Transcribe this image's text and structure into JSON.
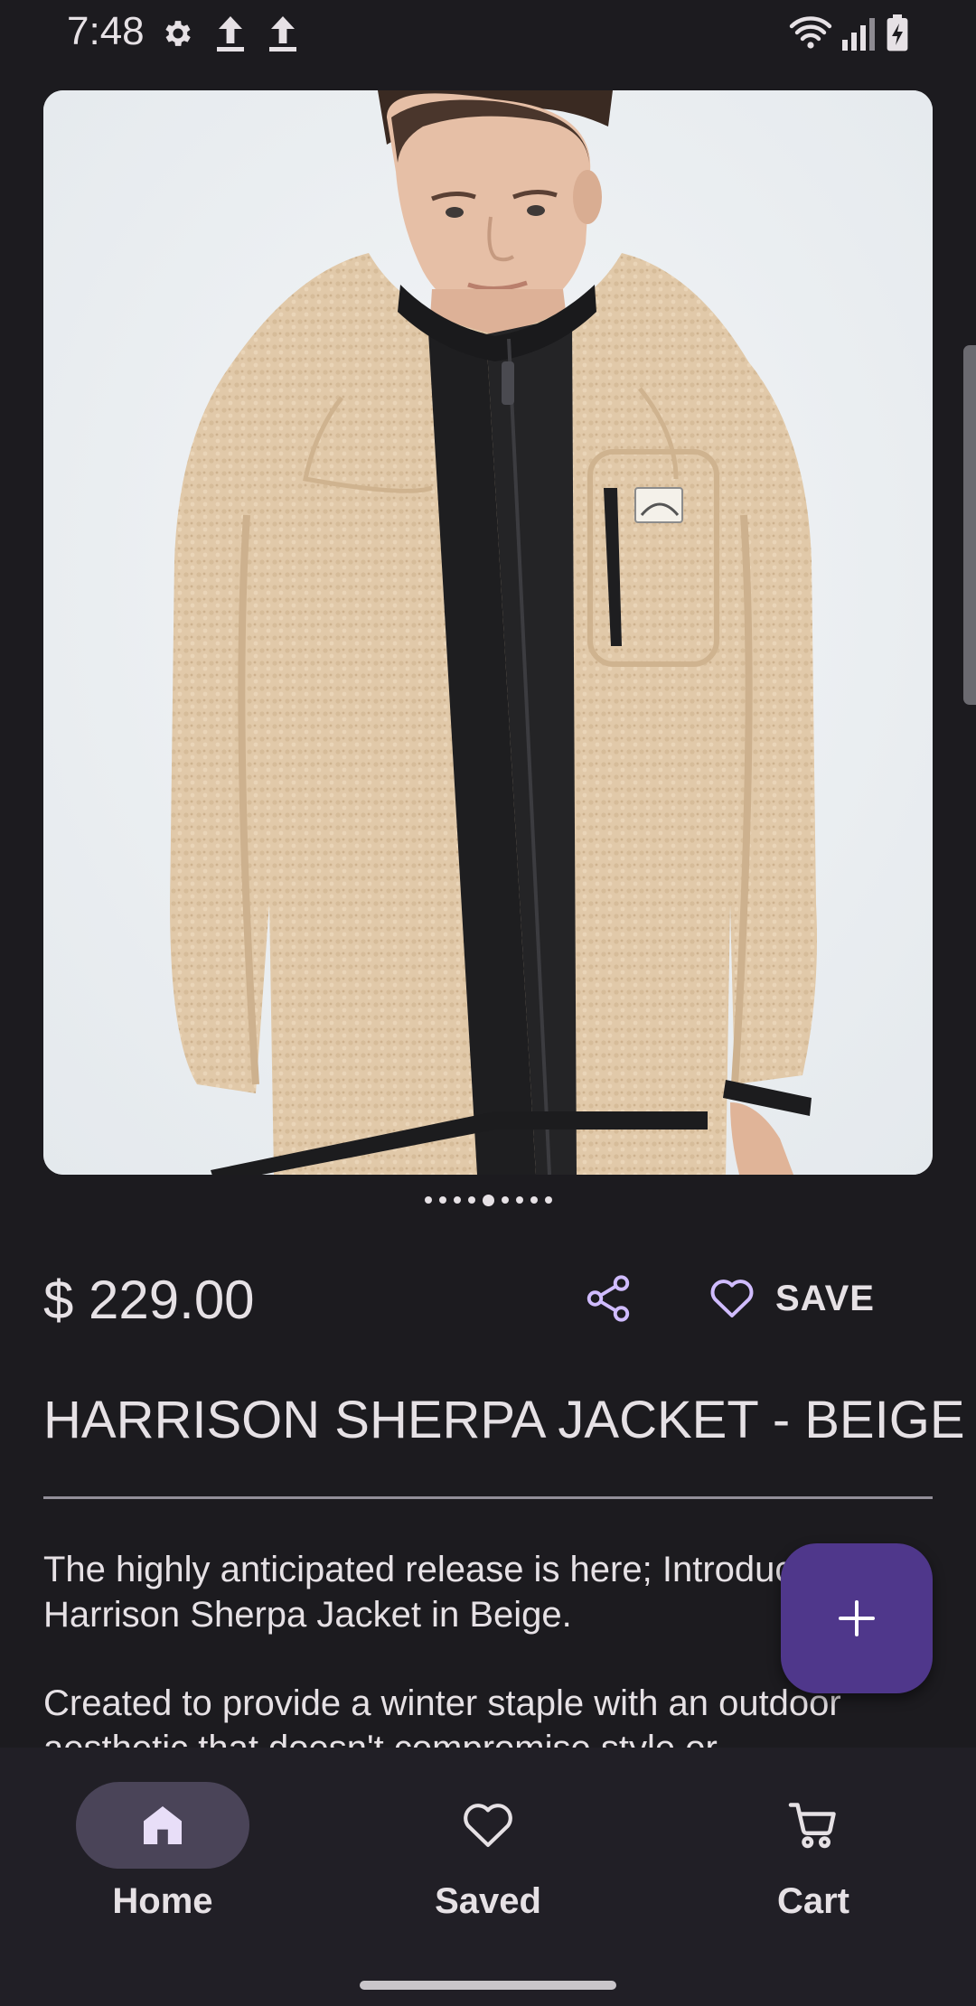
{
  "status_bar": {
    "time": "7:48",
    "left_icons": [
      "gear-icon",
      "upload-icon",
      "upload-icon"
    ],
    "right_icons": [
      "wifi-icon",
      "signal-icon",
      "battery-charging-icon"
    ]
  },
  "product": {
    "image_alt": "HARRISON SHERPA JACKET - BEIGE",
    "carousel": {
      "total": 9,
      "active_index": 4
    },
    "price": "$ 229.00",
    "title": "HARRISON SHERPA JACKET - BEIGE",
    "description": [
      "The highly anticipated release is here; Introducing the Harrison Sherpa Jacket in Beige.",
      "Created to provide a winter staple with an outdoor aesthetic that doesn't compromise style or"
    ]
  },
  "actions": {
    "share_icon": "share-icon",
    "save_label": "SAVE",
    "save_icon": "heart-outline-icon",
    "fab_icon": "plus-icon"
  },
  "bottom_nav": {
    "items": [
      {
        "label": "Home",
        "icon": "home-icon",
        "active": true
      },
      {
        "label": "Saved",
        "icon": "heart-outline-icon",
        "active": false
      },
      {
        "label": "Cart",
        "icon": "cart-icon",
        "active": false
      }
    ]
  },
  "colors": {
    "background": "#1c1b1f",
    "nav_background": "#211f26",
    "accent": "#4f378b",
    "active_indicator": "#4a4458",
    "share_icon": "#d0bcff"
  }
}
